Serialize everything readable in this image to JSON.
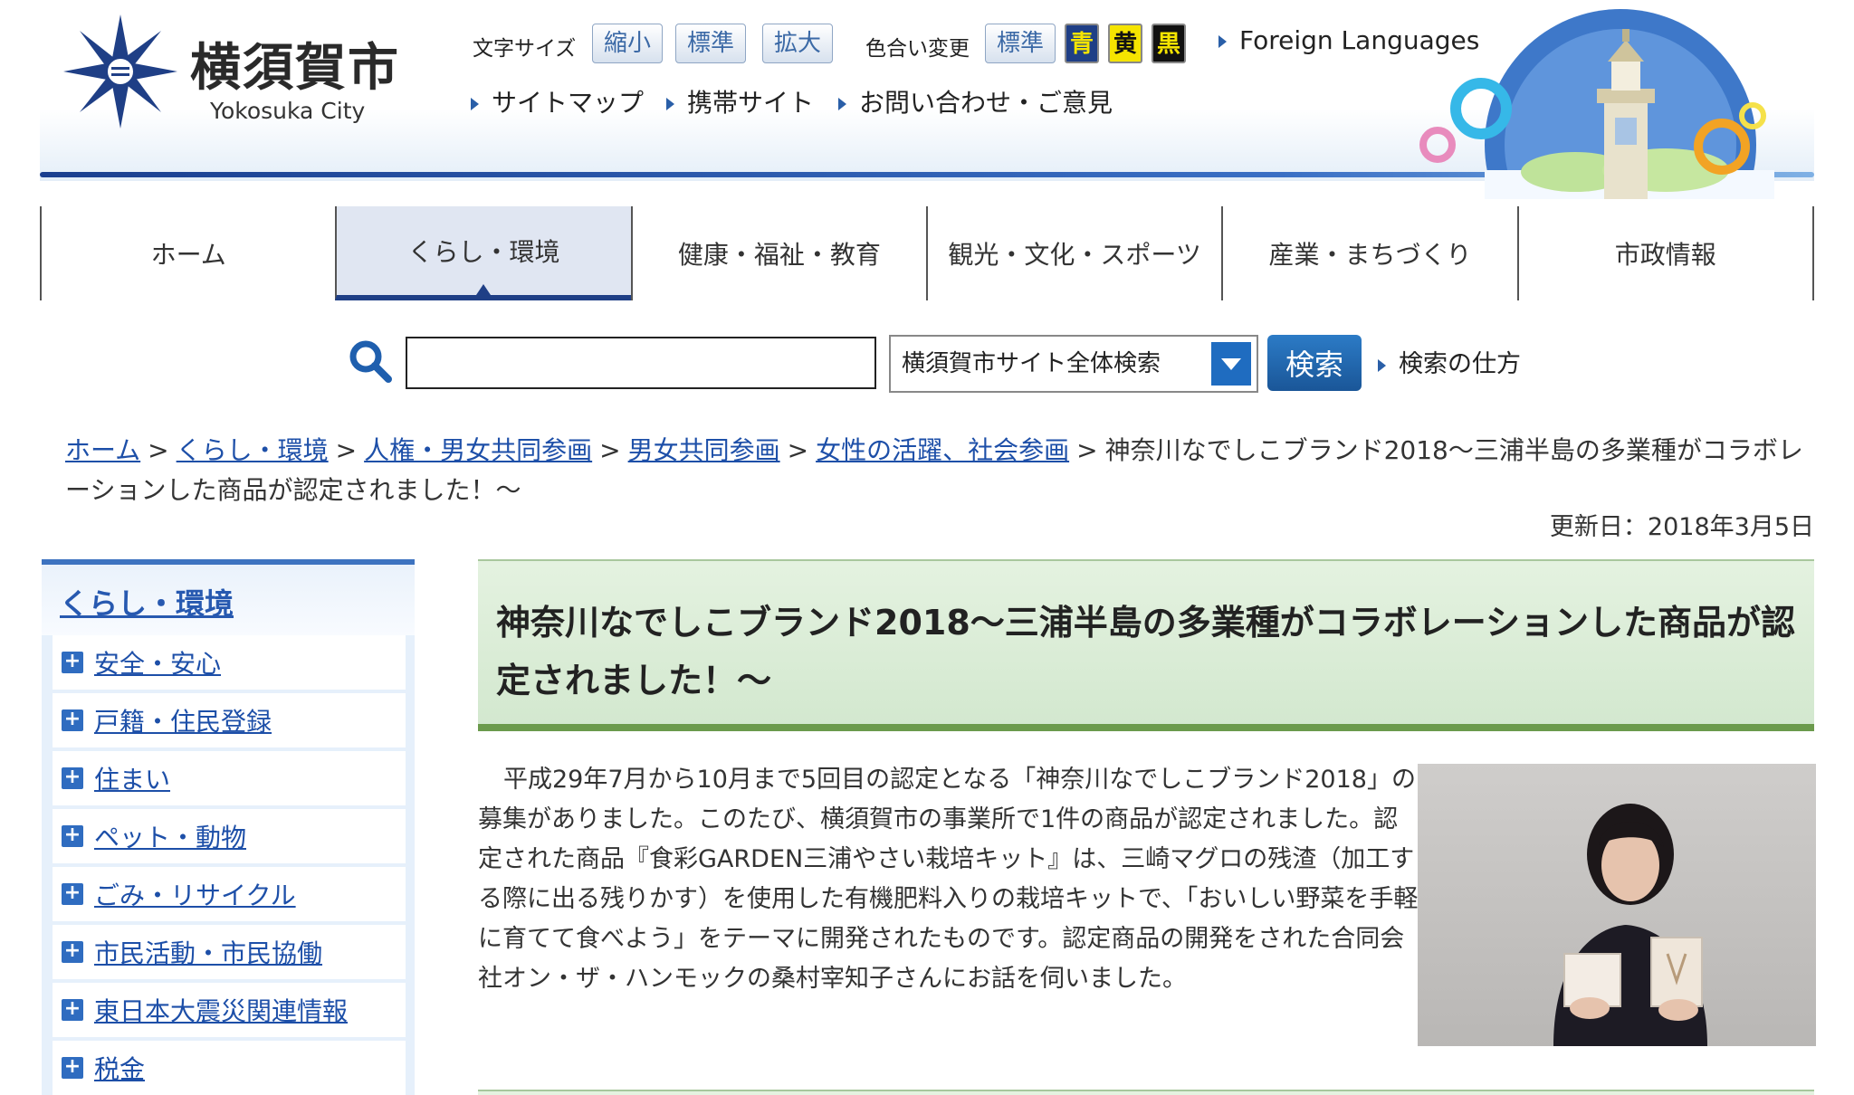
{
  "header": {
    "logo_ja": "横須賀市",
    "logo_en": "Yokosuka City",
    "font_size_label": "文字サイズ",
    "font_size_buttons": [
      "縮小",
      "標準",
      "拡大"
    ],
    "color_label": "色合い変更",
    "color_buttons": [
      {
        "label": "標準",
        "bg": "#dfe7f1",
        "fg": "#3b69a6"
      },
      {
        "label": "青",
        "bg": "#1f3f86",
        "fg": "#f5e400"
      },
      {
        "label": "黄",
        "bg": "#f5e400",
        "fg": "#111111"
      },
      {
        "label": "黒",
        "bg": "#111111",
        "fg": "#f5e400"
      }
    ],
    "foreign_languages": "Foreign Languages",
    "links": [
      "サイトマップ",
      "携帯サイト",
      "お問い合わせ・ご意見"
    ]
  },
  "nav": {
    "items": [
      "ホーム",
      "くらし・環境",
      "健康・福祉・教育",
      "観光・文化・スポーツ",
      "産業・まちづくり",
      "市政情報"
    ],
    "active_index": 1
  },
  "search": {
    "input_value": "",
    "scope": "横須賀市サイト全体検索",
    "button": "検索",
    "howto": "検索の仕方"
  },
  "breadcrumb": {
    "links": [
      "ホーム",
      "くらし・環境",
      "人権・男女共同参画",
      "男女共同参画",
      "女性の活躍、社会参画"
    ],
    "current": "神奈川なでしこブランド2018～三浦半島の多業種がコラボレーションした商品が認定されました！～",
    "separator": ">"
  },
  "updated": "更新日：2018年3月5日",
  "sidebar": {
    "heading": "くらし・環境",
    "items": [
      "安全・安心",
      "戸籍・住民登録",
      "住まい",
      "ペット・動物",
      "ごみ・リサイクル",
      "市民活動・市民協働",
      "東日本大震災関連情報",
      "税金"
    ]
  },
  "article": {
    "title": "神奈川なでしこブランド2018～三浦半島の多業種がコラボレーションした商品が認定されました！～",
    "body": "平成29年7月から10月まで5回目の認定となる「神奈川なでしこブランド2018」の募集がありました。このたび、横須賀市の事業所で1件の商品が認定されました。認定された商品『食彩GARDEN三浦やさい栽培キット』は、三崎マグロの残渣（加工する際に出る残りかす）を使用した有機肥料入りの栽培キットで、「おいしい野菜を手軽に育てて食べよう」をテーマに開発されたものです。認定商品の開発をされた合同会社オン・ザ・ハンモックの桑村宰知子さんにお話を伺いました。"
  },
  "icons": {
    "search": "search-icon",
    "plus": "plus-icon",
    "select_arrow": "chevron-down-icon",
    "link_marker": "triangle-right-icon"
  },
  "colors": {
    "brand_blue": "#1f3f86",
    "link_blue": "#1d4fa8",
    "title_green_bg": "#dcedd8",
    "title_green_border": "#6b9a4c"
  }
}
